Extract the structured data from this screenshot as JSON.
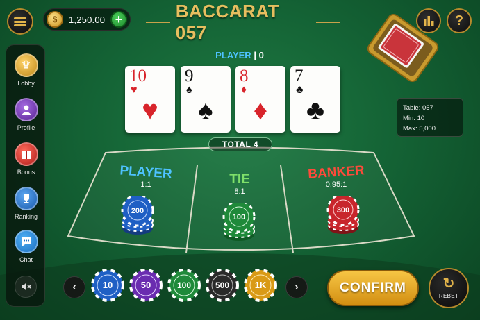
{
  "header": {
    "balance": "1,250.00",
    "coin_symbol": "$",
    "add_symbol": "+",
    "title": "BACCARAT 057",
    "help_symbol": "?"
  },
  "sidebar": {
    "items": [
      {
        "label": "Lobby",
        "icon": "crown-icon",
        "color": "#d9a52a"
      },
      {
        "label": "Profile",
        "icon": "user-icon",
        "color": "#7b3fbf"
      },
      {
        "label": "Bonus",
        "icon": "gift-icon",
        "color": "#d8332d"
      },
      {
        "label": "Ranking",
        "icon": "trophy-icon",
        "color": "#2f7fd1"
      },
      {
        "label": "Chat",
        "icon": "chat-icon",
        "color": "#2d8ed8"
      }
    ],
    "mute_icon": "speaker-muted-icon"
  },
  "table_info": {
    "table": "Table: 057",
    "min": "Min: 10",
    "max": "Max: 5,000"
  },
  "hand": {
    "label": "PLAYER",
    "separator": "|",
    "score": "0",
    "total": "TOTAL 4",
    "cards": [
      {
        "rank": "10",
        "suit": "♥",
        "color": "red"
      },
      {
        "rank": "9",
        "suit": "♠",
        "color": "black"
      },
      {
        "rank": "8",
        "suit": "♦",
        "color": "red"
      },
      {
        "rank": "7",
        "suit": "♣",
        "color": "black"
      }
    ]
  },
  "bet_zones": [
    {
      "name": "PLAYER",
      "odds": "1:1",
      "color": "#4ec2ff",
      "chip": "200",
      "chip_color": "#1f5fc4"
    },
    {
      "name": "TIE",
      "odds": "8:1",
      "color": "#7ee06a",
      "chip": "100",
      "chip_color": "#1f8a3a"
    },
    {
      "name": "BANKER",
      "odds": "0.95:1",
      "color": "#ff4a3a",
      "chip": "300",
      "chip_color": "#c8262c"
    }
  ],
  "chips": [
    {
      "value": "10",
      "color": "#1f5fc4"
    },
    {
      "value": "50",
      "color": "#6a2cb0"
    },
    {
      "value": "100",
      "color": "#1f8a3a"
    },
    {
      "value": "500",
      "color": "#2a2a2a"
    },
    {
      "value": "1K",
      "color": "#d99a16"
    }
  ],
  "controls": {
    "prev": "‹",
    "next": "›",
    "confirm": "CONFIRM",
    "rebet": "REBET",
    "rebet_symbol": "↻"
  },
  "colors": {
    "felt": "#146335",
    "gold": "#e6be5f",
    "player": "#4ec2ff",
    "tie": "#7ee06a",
    "banker": "#ff4a3a"
  }
}
